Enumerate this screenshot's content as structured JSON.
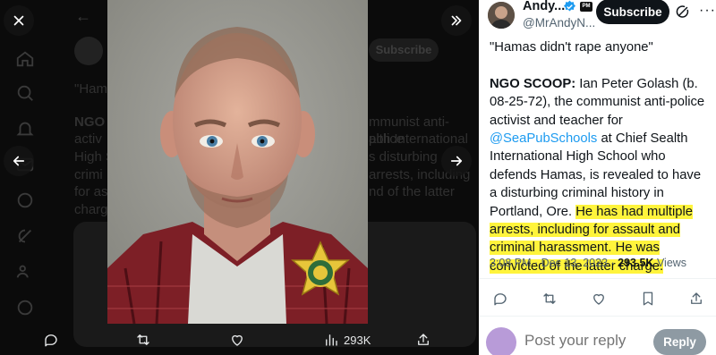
{
  "viewer": {
    "views_count": "293K"
  },
  "author": {
    "name": "Andy...",
    "handle": "@MrAndyN...",
    "affiliate_badge": "PM",
    "subscribe_label": "Subscribe"
  },
  "tweet": {
    "quote": "\"Hamas didn't rape anyone\"",
    "lead_bold": "NGO SCOOP:",
    "body_1": " Ian Peter Golash (b. 08-25-72), the communist anti-police activist and teacher for ",
    "link": "@SeaPubSchools",
    "body_2": " at Chief Sealth International High School who defends Hamas, is revealed to have a disturbing criminal history in Portland, Ore. ",
    "highlight": "He has had multiple arrests, including for assault and criminal harassment. He was convicted of the latter charge.",
    "timestamp": "3:08 PM · Dec 13, 2023",
    "views_number": "293.5K",
    "views_label": "Views"
  },
  "reply": {
    "placeholder": "Post your reply",
    "button_label": "Reply"
  },
  "background": {
    "subscribe_label": "Subscribe",
    "ghost_quote": "\"Ham",
    "ghost_lines": [
      "NGO S",
      "activ",
      "High S",
      "crimi",
      "for as",
      "charg"
    ],
    "ghost_right_lines": [
      "mmunist anti-police",
      "alth International",
      "s disturbing",
      "arrests, including",
      "nd of the latter"
    ]
  },
  "colors": {
    "highlight": "#fff43c",
    "link": "#1d9bf0",
    "verified": "#1d9bf0"
  },
  "icons": [
    "close-icon",
    "collapse-panel-icon",
    "prev-arrow-icon",
    "next-arrow-icon",
    "comment-icon",
    "repost-icon",
    "like-icon",
    "views-icon",
    "share-icon",
    "bookmark-icon",
    "grok-icon",
    "more-icon",
    "verified-badge-icon"
  ]
}
